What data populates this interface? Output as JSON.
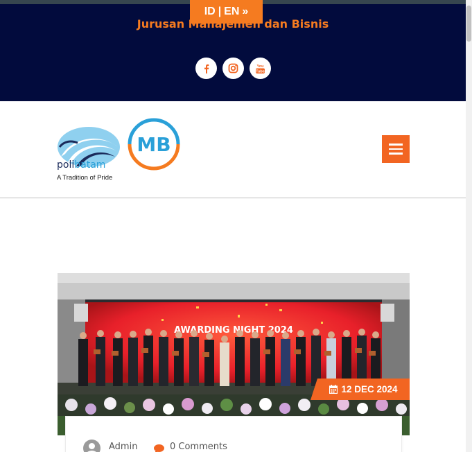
{
  "header": {
    "department_title": "Jurusan Manajemen dan Bisnis",
    "language_switch": {
      "id": "ID",
      "separator": "|",
      "en": "EN",
      "arrow": "»"
    },
    "socials": [
      {
        "icon": "facebook-icon"
      },
      {
        "icon": "instagram-icon"
      },
      {
        "icon": "youtube-icon",
        "text": "You Tube"
      }
    ]
  },
  "nav": {
    "polibatam_logo": {
      "name_part1": "poli",
      "name_part2": "batam",
      "tagline": "A Tradition of Pride"
    },
    "mb_logo": {
      "text": "MB"
    },
    "menu_icon": "hamburger-icon"
  },
  "post": {
    "image_banner_text": "AWARDING NIGHT 2024",
    "date": "12 DEC 2024",
    "author": "Admin",
    "comments": "0 Comments"
  },
  "colors": {
    "top_bar": "#020b3d",
    "accent": "#f26522",
    "dept_title": "#f57b20"
  }
}
